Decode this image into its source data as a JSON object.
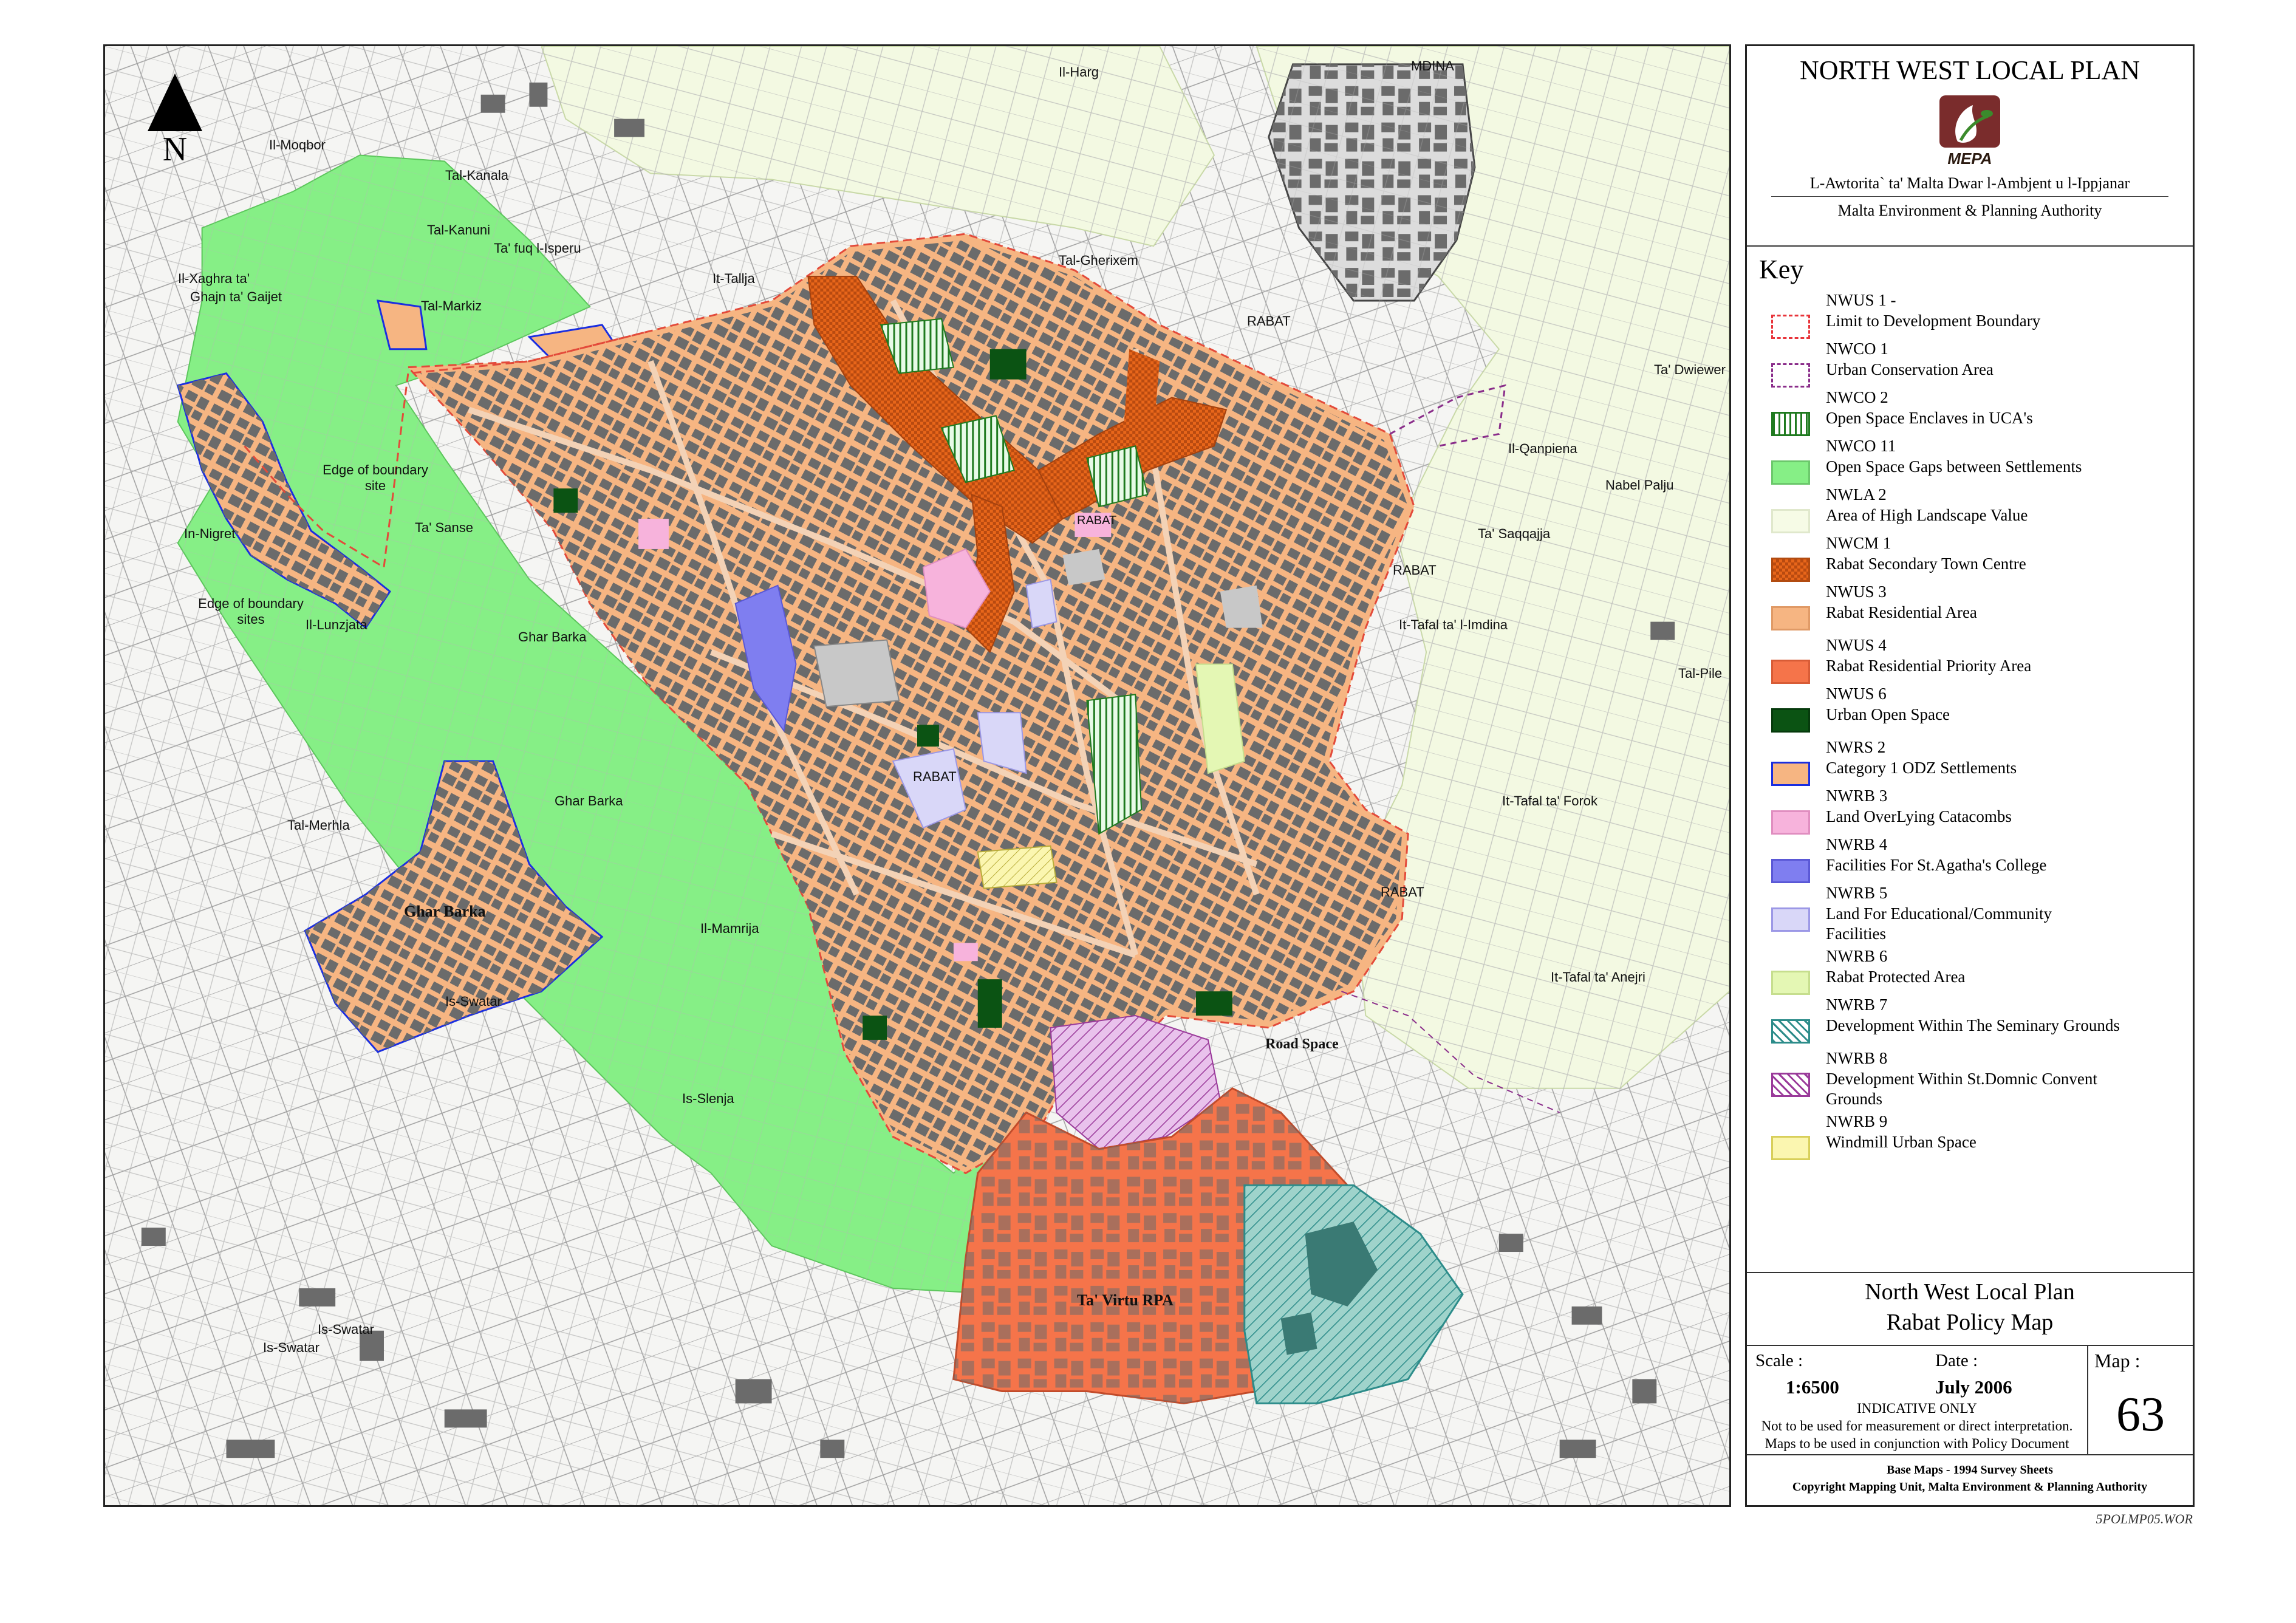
{
  "map": {
    "north_label": "N",
    "labels": [
      {
        "id": "edge-boundary-site",
        "text": "Edge of boundary\nsite"
      },
      {
        "id": "edge-boundary-sites",
        "text": "Edge of boundary\nsites"
      },
      {
        "id": "ghar-barka",
        "text": "Ghar Barka"
      },
      {
        "id": "ta-virtu-rpa",
        "text": "Ta' Virtu RPA"
      },
      {
        "id": "road-space",
        "text": "Road Space"
      },
      {
        "id": "rabat-1",
        "text": "RABAT"
      },
      {
        "id": "rabat-2",
        "text": "RABAT"
      },
      {
        "id": "rabat-3",
        "text": "RABAT"
      },
      {
        "id": "rabat-4",
        "text": "RABAT"
      },
      {
        "id": "rabat-5",
        "text": "RABAT"
      },
      {
        "id": "mdina",
        "text": "MDINA"
      },
      {
        "id": "il-harg",
        "text": "Il-Harg"
      },
      {
        "id": "ghar-barka-2",
        "text": "Ghar Barka"
      },
      {
        "id": "ghar-barka-3",
        "text": "Ghar Barka"
      },
      {
        "id": "il-mamrija",
        "text": "Il-Mamrija"
      },
      {
        "id": "tal-merhla",
        "text": "Tal-Merhla"
      },
      {
        "id": "is-swatar",
        "text": "Is-Swatar"
      },
      {
        "id": "is-swatar-2",
        "text": "Is-Swatar"
      },
      {
        "id": "it-tafal-ta-forok",
        "text": "It-Tafal ta' Forok"
      },
      {
        "id": "it-tafal-ta-l-imdina",
        "text": "It-Tafal ta' l-Imdina"
      },
      {
        "id": "it-tafal-ta-anejri",
        "text": "It-Tafal ta' Anejri"
      },
      {
        "id": "ta-saqqajja",
        "text": "Ta' Saqqajja"
      },
      {
        "id": "il-qanpiena",
        "text": "Il-Qanpiena"
      },
      {
        "id": "nabel-palju",
        "text": "Nabel Palju"
      },
      {
        "id": "is-slenja",
        "text": "Is-Slenja"
      },
      {
        "id": "il-lunzjata",
        "text": "Il-Lunzjata"
      },
      {
        "id": "tal-gherixem",
        "text": "Tal-Gherixem"
      },
      {
        "id": "ta-fuq-l-isperu",
        "text": "Ta' fuq l-Isperu"
      },
      {
        "id": "it-tallja",
        "text": "It-Tallja"
      },
      {
        "id": "tal-markiz",
        "text": "Tal-Markiz"
      },
      {
        "id": "tal-kanuni",
        "text": "Tal-Kanuni"
      },
      {
        "id": "tal-kanala",
        "text": "Tal-Kanala"
      },
      {
        "id": "il-moqbor",
        "text": "Il-Moqbor"
      },
      {
        "id": "ta-dwiewer",
        "text": "Ta' Dwiewer"
      },
      {
        "id": "ghajn-il-kbira",
        "text": "Ghajn ta' Gaijet"
      },
      {
        "id": "tal-pilar",
        "text": "Tal-Pile"
      },
      {
        "id": "il-xaghra",
        "text": "Il-Xaghra ta'"
      },
      {
        "id": "in-nigret",
        "text": "In-Nigret"
      },
      {
        "id": "ta-sanse",
        "text": "Ta' Sanse"
      },
      {
        "id": "is-swatar-3",
        "text": "Is-Swatar"
      }
    ]
  },
  "header": {
    "title": "NORTH WEST LOCAL PLAN",
    "logo_text": "MEPA",
    "authority_mt": "L-Awtorita` ta' Malta Dwar l-Ambjent u l-Ippjanar",
    "authority_en": "Malta Environment & Planning Authority"
  },
  "key": {
    "title": "Key",
    "items": [
      {
        "code": "NWUS 1 -",
        "desc": "Limit to Development Boundary",
        "fill": "#ffffff",
        "border": "#e8343a",
        "style": "dashed"
      },
      {
        "code": "NWCO 1",
        "desc": "Urban Conservation Area",
        "fill": "#ffffff",
        "border": "#8a2d8a",
        "style": "dashed"
      },
      {
        "code": "NWCO 2",
        "desc": "Open Space Enclaves in UCA's",
        "fill": "#ffffff",
        "border": "#1f7a1f",
        "style": "vstripe"
      },
      {
        "code": "NWCO 11",
        "desc": "Open Space Gaps between Settlements",
        "fill": "#86ef86",
        "border": "#6cc86c",
        "style": "solid"
      },
      {
        "code": "NWLA 2",
        "desc": "Area of High Landscape Value",
        "fill": "#f6fbe6",
        "border": "#e0e8cc",
        "style": "solid"
      },
      {
        "code": "NWCM 1",
        "desc": "Rabat Secondary Town Centre",
        "fill": "#e8661a",
        "border": "#b24b10",
        "style": "check"
      },
      {
        "code": "NWUS 3",
        "desc": "Rabat Residential Area",
        "fill": "#f6b582",
        "border": "#e09a66",
        "style": "solid"
      },
      {
        "code": "NWUS 4",
        "desc": "Rabat Residential Priority Area",
        "fill": "#f5744a",
        "border": "#d85c36",
        "style": "solid"
      },
      {
        "code": "NWUS 6",
        "desc": "Urban Open Space",
        "fill": "#0b5313",
        "border": "#063a0c",
        "style": "solid"
      },
      {
        "code": "NWRS 2",
        "desc": "Category 1 ODZ Settlements",
        "fill": "#f6b582",
        "border": "#1a2ee0",
        "style": "solid"
      },
      {
        "code": "NWRB 3",
        "desc": "Land OverLying Catacombs",
        "fill": "#f7b3dc",
        "border": "#e08ec0",
        "style": "solid"
      },
      {
        "code": "NWRB 4",
        "desc": "Facilities For St.Agatha's College",
        "fill": "#7f7ef0",
        "border": "#5a58d6",
        "style": "solid"
      },
      {
        "code": "NWRB 5",
        "desc": "Land For Educational/Community\nFacilities",
        "fill": "#d9d7f8",
        "border": "#9c98e6",
        "style": "solid"
      },
      {
        "code": "NWRB 6",
        "desc": "Rabat Protected Area",
        "fill": "#e4f7b4",
        "border": "#c6de8e",
        "style": "solid"
      },
      {
        "code": "NWRB 7",
        "desc": "Development Within The Seminary Grounds",
        "fill": "#ffffff",
        "border": "#2c8c8a",
        "style": "dstripe-teal"
      },
      {
        "code": "NWRB 8",
        "desc": "Development Within St.Domnic Convent\nGrounds",
        "fill": "#ffffff",
        "border": "#9a3a9a",
        "style": "dstripe-purple"
      },
      {
        "code": "NWRB 9",
        "desc": "Windmill Urban Space",
        "fill": "#fbf6b0",
        "border": "#d8cf5a",
        "style": "solid"
      }
    ]
  },
  "titlebox": {
    "line1": "North West Local Plan",
    "line2": "Rabat Policy Map"
  },
  "meta": {
    "scale_label": "Scale :",
    "scale_value": "1:6500",
    "date_label": "Date :",
    "date_value": "July 2006",
    "map_label": "Map :",
    "map_number": "63",
    "note_line1": "INDICATIVE ONLY",
    "note_line2": "Not to be used for measurement or direct interpretation.",
    "note_line3": "Maps to be used in conjunction with Policy Document"
  },
  "base": {
    "line1": "Base Maps - 1994 Survey Sheets",
    "line2": "Copyright Mapping Unit, Malta Environment & Planning Authority"
  },
  "file_ref": "5POLMP05.WOR",
  "colors": {
    "open_space_gap": "#86ef86",
    "residential": "#f6b582",
    "priority": "#f5744a",
    "town_centre": "#e8661a",
    "buildings": "#6b6b6b",
    "landscape": "#f6fbe6",
    "seminary": "#8fc9c1",
    "boundary_red": "#e8343a",
    "boundary_blue": "#1a2ee0"
  }
}
